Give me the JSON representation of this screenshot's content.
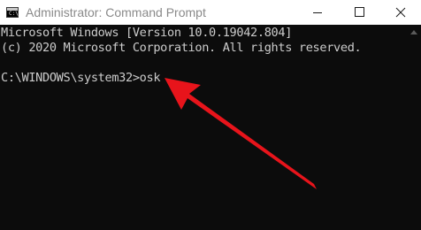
{
  "window": {
    "title": "Administrator: Command Prompt",
    "icon": "command-prompt-icon"
  },
  "controls": {
    "minimize": "minimize-icon",
    "maximize": "maximize-icon",
    "close": "close-icon"
  },
  "console": {
    "lines": [
      "Microsoft Windows [Version 10.0.19042.804]",
      "(c) 2020 Microsoft Corporation. All rights reserved.",
      "",
      "C:\\WINDOWS\\system32>osk"
    ]
  },
  "annotation": {
    "arrow_color": "#e8141b",
    "icon": "red-arrow"
  },
  "colors": {
    "console_background": "#0c0c0c",
    "console_text": "#cccccc",
    "titlebar_background": "#ffffff"
  }
}
